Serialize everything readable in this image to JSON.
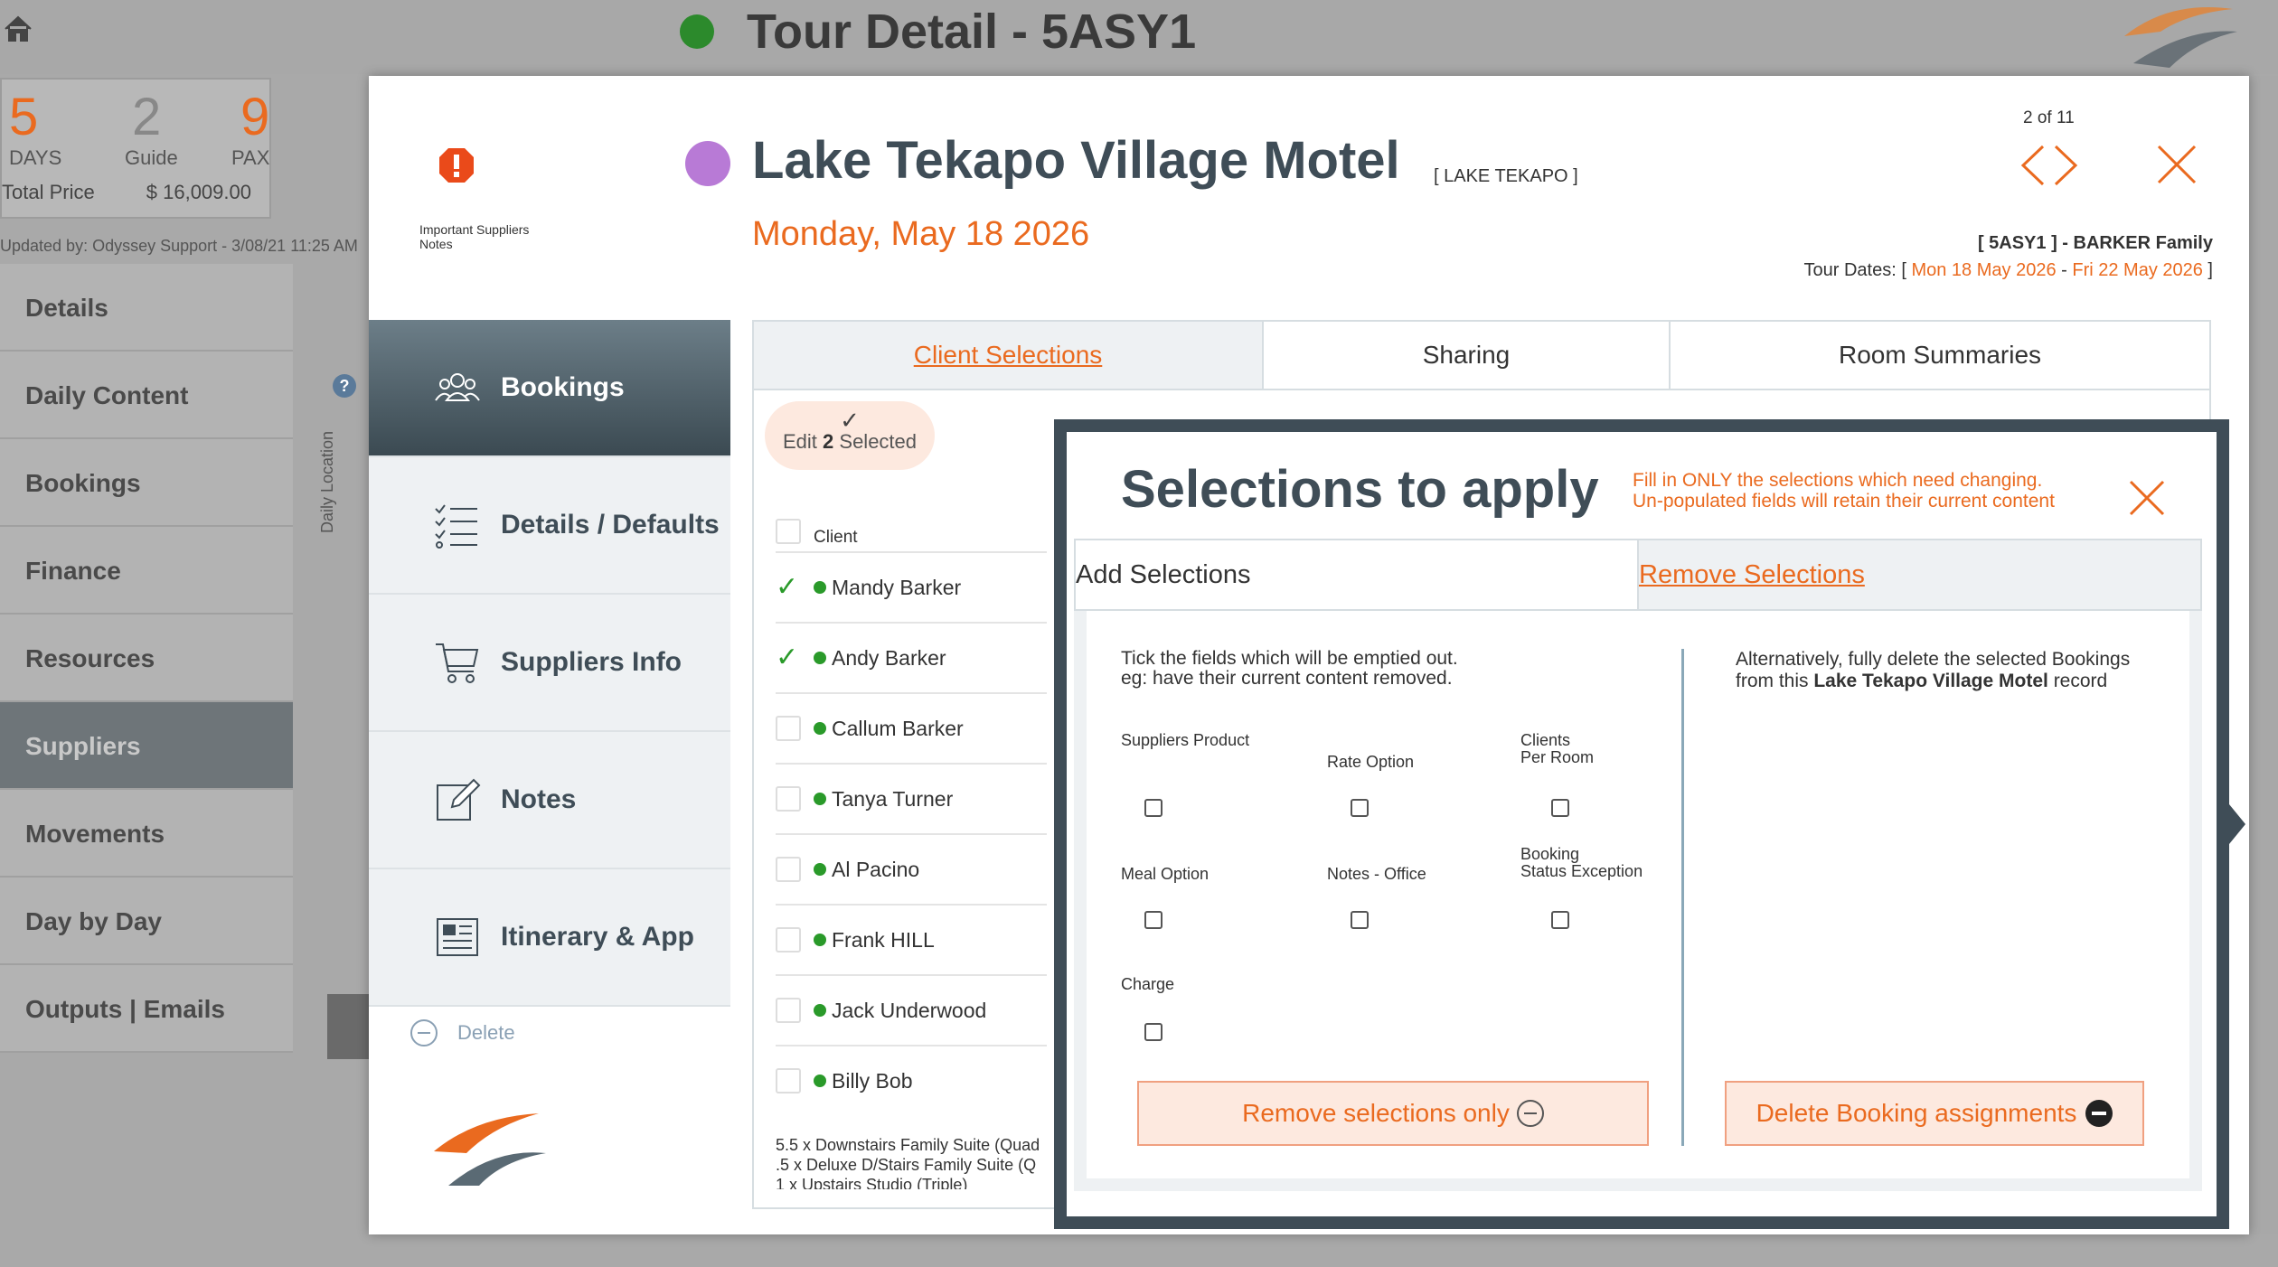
{
  "background": {
    "title": "Tour Detail - 5ASY1",
    "stats": [
      {
        "value": "5",
        "label": "DAYS",
        "color": "#ea6a1f"
      },
      {
        "value": "2",
        "label": "Guide",
        "color": "#888888"
      },
      {
        "value": "9",
        "label": "PAX",
        "color": "#ea6a1f"
      }
    ],
    "total_price_label": "Total Price",
    "total_price_value": "$ 16,009.00",
    "updated_by": "Updated by: Odyssey Support - 3/08/21 11:25 AM",
    "nav": [
      "Details",
      "Daily Content",
      "Bookings",
      "Finance",
      "Resources",
      "Suppliers",
      "Movements",
      "Day by Day",
      "Outputs | Emails"
    ],
    "active_nav": "Suppliers",
    "daily_location_label": "Daily Location"
  },
  "modal": {
    "important_notes_label": "Important Suppliers Notes",
    "supplier_name": "Lake Tekapo Village Motel",
    "location_tag": "[ LAKE TEKAPO ]",
    "date": "Monday, May 18 2026",
    "pager": "2 of 11",
    "tour_ref": "[ 5ASY1 ] - BARKER Family",
    "tour_dates_label": "Tour Dates: [",
    "tour_start": "Mon 18 May 2026",
    "tour_dates_sep": " - ",
    "tour_end": "Fri 22 May 2026",
    "tour_dates_close": " ]",
    "menu": [
      "Bookings",
      "Details / Defaults",
      "Suppliers Info",
      "Notes",
      "Itinerary & App"
    ],
    "delete_label": "Delete",
    "tabs": [
      "Client Selections",
      "Sharing",
      "Room Summaries"
    ],
    "edit_selected": {
      "prefix": "Edit",
      "count": "2",
      "suffix": "Selected"
    },
    "client_header": "Client",
    "clients": [
      {
        "name": "Mandy Barker",
        "checked": true
      },
      {
        "name": "Andy Barker",
        "checked": true
      },
      {
        "name": "Callum Barker",
        "checked": false
      },
      {
        "name": "Tanya Turner",
        "checked": false
      },
      {
        "name": "Al Pacino",
        "checked": false
      },
      {
        "name": "Frank HILL",
        "checked": false
      },
      {
        "name": "Jack Underwood",
        "checked": false
      },
      {
        "name": "Billy Bob",
        "checked": false
      }
    ],
    "room_notes": [
      "5.5 x Downstairs Family Suite (Quad",
      ".5 x Deluxe D/Stairs Family Suite (Q",
      "1 x Upstairs Studio (Triple)"
    ]
  },
  "selections": {
    "title": "Selections to apply",
    "note_line1": "Fill in ONLY the selections which need changing.",
    "note_line2": "Un-populated fields will retain their current content",
    "tabs": [
      "Add Selections",
      "Remove Selections"
    ],
    "instr_line1": "Tick the fields which will be emptied out.",
    "instr_line2": "eg: have their current content removed.",
    "fields": {
      "suppliers_product": "Suppliers Product",
      "rate_option": "Rate Option",
      "clients_per_room_1": "Clients",
      "clients_per_room_2": "Per Room",
      "meal_option": "Meal Option",
      "notes_office": "Notes - Office",
      "booking_status_1": "Booking",
      "booking_status_2": "Status Exception",
      "charge": "Charge"
    },
    "alt_pre": "Alternatively, fully delete the selected Bookings from this",
    "alt_bold": "Lake Tekapo Village Motel",
    "alt_post": "record",
    "remove_btn": "Remove selections only",
    "delete_btn": "Delete Booking assignments"
  },
  "colors": {
    "accent": "#ea6a1f",
    "dark": "#3f4d57",
    "green": "#2a9a2a",
    "supplier_dot": "#b87ad6"
  }
}
